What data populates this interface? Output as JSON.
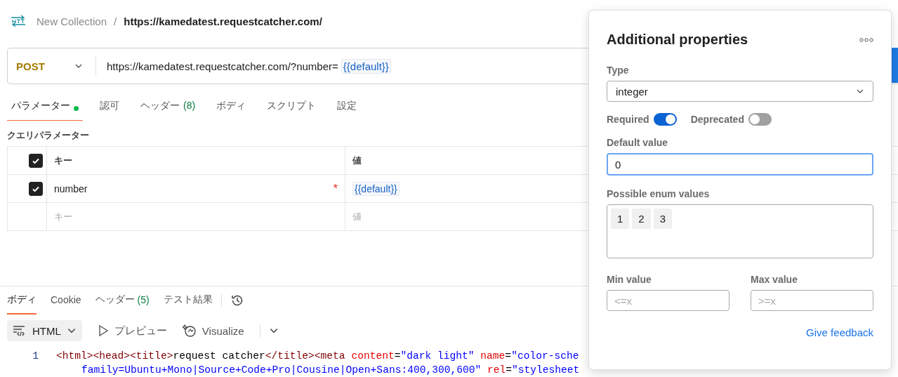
{
  "breadcrumb": {
    "collection": "New Collection",
    "separator": "/",
    "request": "https://kamedatest.requestcatcher.com/"
  },
  "request": {
    "method": "POST",
    "url": "https://kamedatest.requestcatcher.com/?number=",
    "url_variable": "{{default}}"
  },
  "request_tabs": [
    {
      "label": "パラメーター",
      "selected": true,
      "indicator": true
    },
    {
      "label": "認可",
      "selected": false
    },
    {
      "label": "ヘッダー",
      "count": "(8)",
      "selected": false
    },
    {
      "label": "ボディ",
      "selected": false
    },
    {
      "label": "スクリプト",
      "selected": false
    },
    {
      "label": "設定",
      "selected": false
    }
  ],
  "query_params": {
    "title": "クエリパラメーター",
    "columns": [
      "キー",
      "値"
    ],
    "all_checked": true,
    "rows": [
      {
        "checked": true,
        "key": "number",
        "required_mark": "*",
        "value": "{{default}}"
      }
    ],
    "placeholder_row": {
      "key": "キー",
      "value": "値"
    }
  },
  "response": {
    "tabs": [
      {
        "label": "ボディ",
        "selected": true
      },
      {
        "label": "Cookie",
        "selected": false
      },
      {
        "label": "ヘッダー",
        "count": "(5)",
        "selected": false
      },
      {
        "label": "テスト結果",
        "selected": false
      }
    ],
    "format": "HTML",
    "preview": "プレビュー",
    "visualize": "Visualize",
    "code_lines": [
      {
        "number": "1",
        "tokens": [
          {
            "kind": "tag",
            "text": "<html><head><title>"
          },
          {
            "kind": "text",
            "text": "request catcher"
          },
          {
            "kind": "tag",
            "text": "</title><meta"
          },
          {
            "kind": "attr",
            "text": " content"
          },
          {
            "kind": "text",
            "text": "="
          },
          {
            "kind": "string",
            "text": "\"dark light\""
          },
          {
            "kind": "attr",
            "text": " name"
          },
          {
            "kind": "text",
            "text": "="
          },
          {
            "kind": "string",
            "text": "\"color-sche"
          }
        ]
      },
      {
        "tokens": [
          {
            "kind": "string",
            "text": "family=Ubuntu+Mono|Source+Code+Pro|Cousine|Open+Sans:400,300,600\""
          },
          {
            "kind": "attr",
            "text": " rel"
          },
          {
            "kind": "text",
            "text": "="
          },
          {
            "kind": "string",
            "text": "\"stylesheet"
          }
        ]
      }
    ]
  },
  "popover": {
    "title": "Additional properties",
    "type_label": "Type",
    "type_value": "integer",
    "toggles": [
      {
        "label": "Required",
        "on": true
      },
      {
        "label": "Deprecated",
        "on": false
      }
    ],
    "default_label": "Default value",
    "default_value": "0",
    "enum_label": "Possible enum values",
    "enum_values": [
      "1",
      "2",
      "3"
    ],
    "min_label": "Min value",
    "min_placeholder": "<=x",
    "max_label": "Max value",
    "max_placeholder": ">=x",
    "feedback": "Give feedback"
  }
}
